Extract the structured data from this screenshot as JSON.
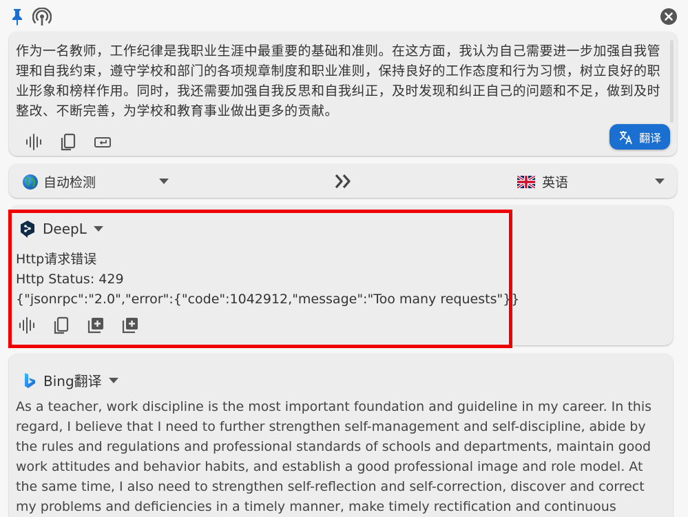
{
  "source": {
    "text": "作为一名教师，工作纪律是我职业生涯中最重要的基础和准则。在这方面，我认为自己需要进一步加强自我管理和自我约束，遵守学校和部门的各项规章制度和职业准则，保持良好的工作态度和行为习惯，树立良好的职业形象和榜样作用。同时，我还需要加强自我反思和自我纠正，及时发现和纠正自己的问题和不足，做到及时整改、不断完善，为学校和教育事业做出更多的贡献。",
    "translate_label": "翻译"
  },
  "languages": {
    "from": "自动检测",
    "to": "英语"
  },
  "deepl": {
    "name": "DeepL",
    "error_title": "Http请求错误",
    "status": "Http Status: 429",
    "body": "{\"jsonrpc\":\"2.0\",\"error\":{\"code\":1042912,\"message\":\"Too many requests\"}}"
  },
  "bing": {
    "name": "Bing翻译",
    "text": "As a teacher, work discipline is the most important foundation and guideline in my career. In this regard, I believe that I need to further strengthen self-management and self-discipline, abide by the rules and regulations and professional standards of schools and departments, maintain good work attitudes and behavior habits, and establish a good professional image and role model. At the same time, I also need to strengthen self-reflection and self-correction, discover and correct my problems and deficiencies in a timely manner, make timely rectification and continuous improvement, and make more contributions to"
  },
  "icons": {
    "pin": "pin-icon",
    "antenna": "broadcast-icon",
    "close": "close-icon",
    "speak": "speaker-wave-icon",
    "copy": "copy-icon",
    "retranslate": "keyboard-return-icon",
    "add": "add-box-icon",
    "translate": "translate-icon",
    "swap": "double-chevron-right-icon",
    "globe": "globe-icon",
    "uk_flag": "uk-flag-icon",
    "deepl": "deepl-logo-icon",
    "bing": "bing-logo-icon"
  },
  "colors": {
    "accent": "#1a6fd1",
    "highlight": "#ee0000"
  }
}
